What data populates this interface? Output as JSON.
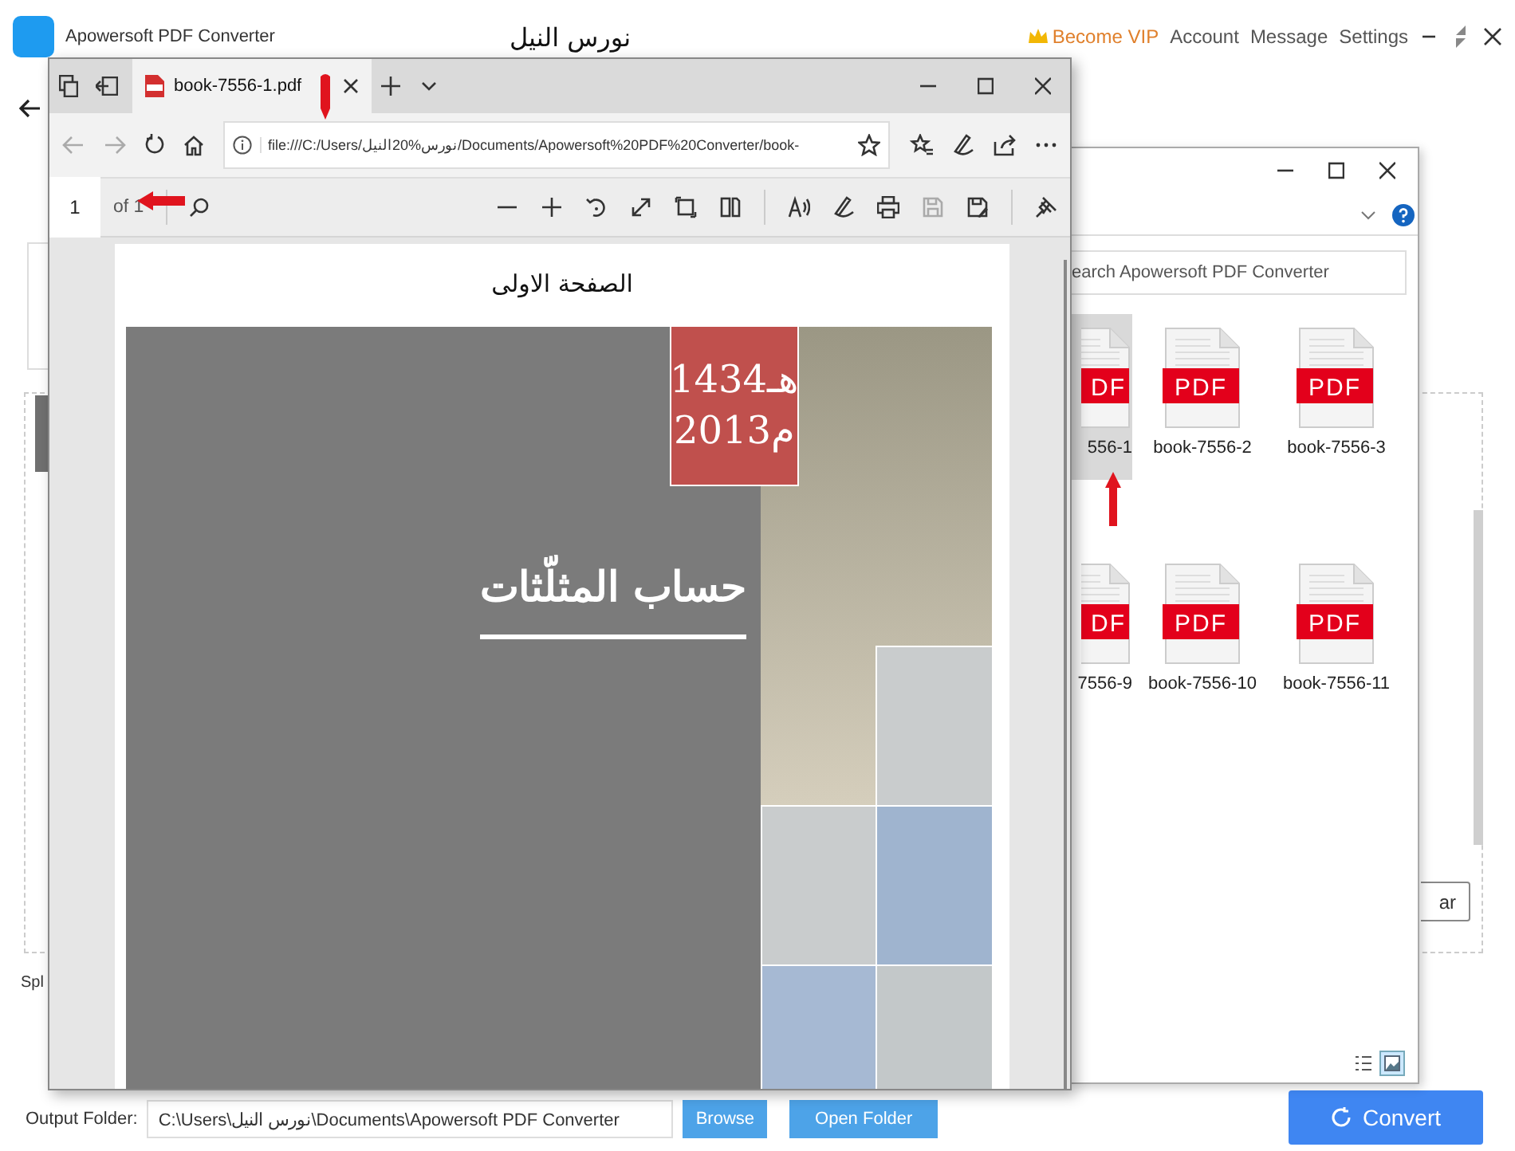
{
  "app": {
    "title": "Apowersoft PDF Converter",
    "user_name": "نورس النيل",
    "header_links": [
      {
        "label": "Become VIP",
        "kind": "vip"
      },
      {
        "label": "Account",
        "kind": "link"
      },
      {
        "label": "Message",
        "kind": "link"
      },
      {
        "label": "Settings",
        "kind": "link"
      }
    ],
    "split_label": "Spl",
    "clear_button": "ar",
    "output_folder": {
      "label": "Output Folder:",
      "path": "C:\\Users\\نورس النيل\\Documents\\Apowersoft PDF Converter",
      "buttons": [
        "Browse",
        "Open Folder"
      ]
    },
    "convert_button": "Convert"
  },
  "browser": {
    "tab": {
      "title": "book-7556-1.pdf"
    },
    "address": "file:///C:/Users/نورس%20النيل/Documents/Apowersoft%20PDF%20Converter/book-",
    "pdf_toolbar": {
      "page": "1",
      "page_count": "of 1"
    },
    "page": {
      "heading": "الصفحة الاولى",
      "cover": {
        "year_hijri": "1434هـ",
        "year_gregorian": "2013م",
        "title": "حساب المثلّثات"
      }
    }
  },
  "explorer": {
    "search": {
      "placeholder": "earch Apowersoft PDF Converter"
    },
    "files": [
      {
        "name": "556-1",
        "icon_text": "DF",
        "partial": true,
        "selected": true
      },
      {
        "name": "book-7556-2",
        "icon_text": "PDF",
        "partial": false,
        "selected": false
      },
      {
        "name": "book-7556-3",
        "icon_text": "PDF",
        "partial": false,
        "selected": false
      },
      {
        "name": "7556-9",
        "icon_text": "DF",
        "partial": true,
        "selected": false
      },
      {
        "name": "book-7556-10",
        "icon_text": "PDF",
        "partial": false,
        "selected": false
      },
      {
        "name": "book-7556-11",
        "icon_text": "PDF",
        "partial": false,
        "selected": false
      }
    ],
    "view_modes": [
      {
        "kind": "details",
        "selected": false
      },
      {
        "kind": "thumbnails",
        "selected": true
      }
    ]
  }
}
